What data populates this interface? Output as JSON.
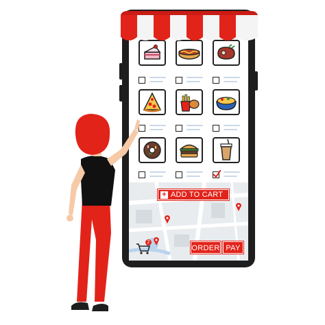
{
  "colors": {
    "accent": "#e2231a",
    "phone_body": "#1e1e1e",
    "map_bg": "#e9ecef",
    "skin": "#f6c9a7",
    "shirt": "#111111",
    "pants": "#e2231a",
    "hair": "#e2231a"
  },
  "menu": {
    "items": [
      {
        "icon": "cake-slice-icon",
        "checked": false
      },
      {
        "icon": "hot-dog-icon",
        "checked": false
      },
      {
        "icon": "steak-icon",
        "checked": false
      },
      {
        "icon": "pizza-slice-icon",
        "checked": false
      },
      {
        "icon": "fries-drumstick-icon",
        "checked": false
      },
      {
        "icon": "salad-bowl-icon",
        "checked": false
      },
      {
        "icon": "donut-icon",
        "checked": false
      },
      {
        "icon": "burger-icon",
        "checked": false
      },
      {
        "icon": "drink-cup-icon",
        "checked": true
      }
    ]
  },
  "cart": {
    "add_label": "ADD TO CART",
    "count": "2"
  },
  "actions": {
    "order_label": "ORDER",
    "pay_label": "PAY"
  }
}
